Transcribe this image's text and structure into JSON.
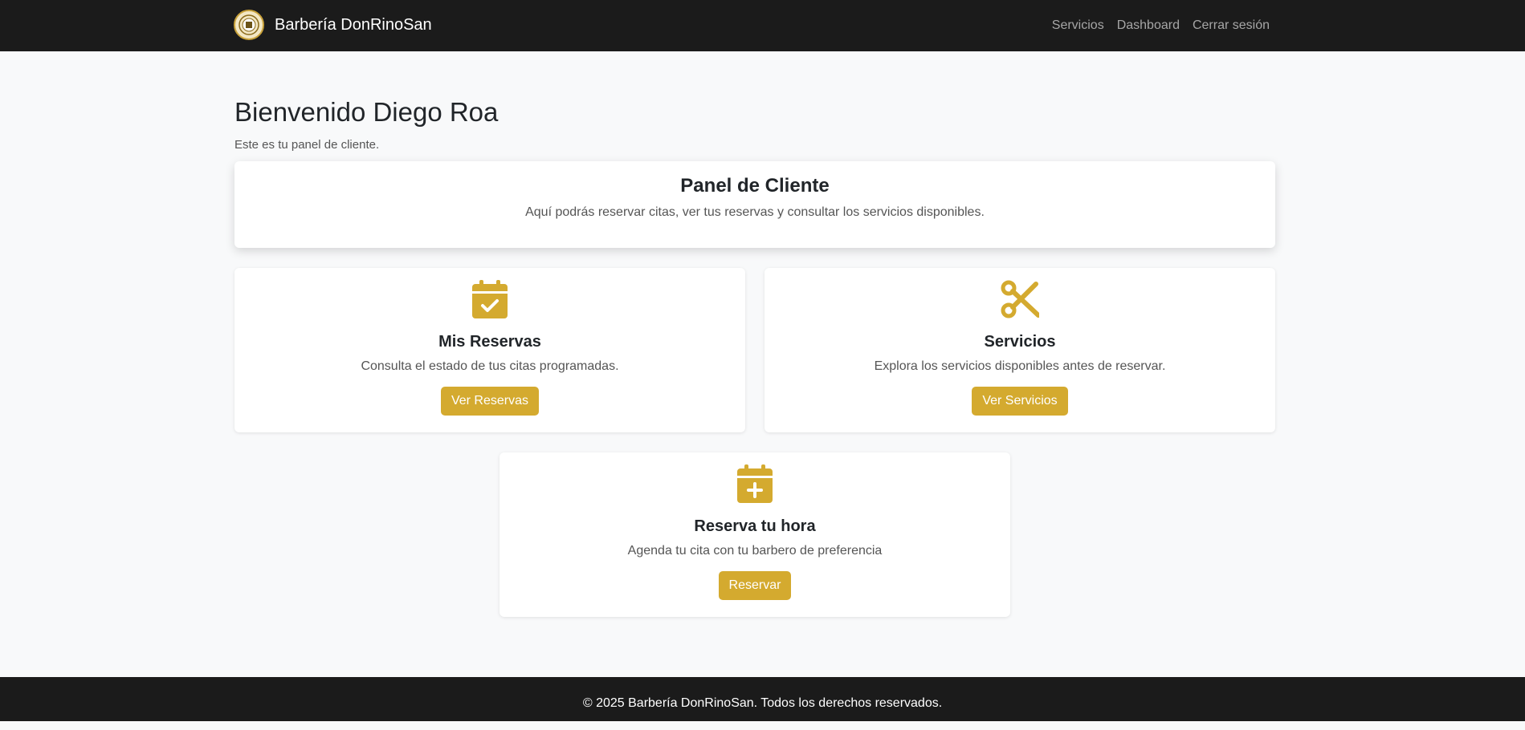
{
  "navbar": {
    "brand": "Barbería DonRinoSan",
    "links": [
      "Servicios",
      "Dashboard",
      "Cerrar sesión"
    ]
  },
  "welcome": {
    "title": "Bienvenido Diego Roa",
    "subtitle": "Este es tu panel de cliente."
  },
  "panel": {
    "title": "Panel de Cliente",
    "text": "Aquí podrás reservar citas, ver tus reservas y consultar los servicios disponibles."
  },
  "cards": [
    {
      "icon": "calendar-check-icon",
      "title": "Mis Reservas",
      "text": "Consulta el estado de tus citas programadas.",
      "button": "Ver Reservas"
    },
    {
      "icon": "scissors-icon",
      "title": "Servicios",
      "text": "Explora los servicios disponibles antes de reservar.",
      "button": "Ver Servicios"
    },
    {
      "icon": "calendar-plus-icon",
      "title": "Reserva tu hora",
      "text": "Agenda tu cita con tu barbero de preferencia",
      "button": "Reservar"
    }
  ],
  "footer": {
    "text": "© 2025 Barbería DonRinoSan. Todos los derechos reservados."
  },
  "colors": {
    "accent": "#d4aa2f",
    "navbar": "#1b1b1b",
    "background": "#f8f9fa"
  }
}
